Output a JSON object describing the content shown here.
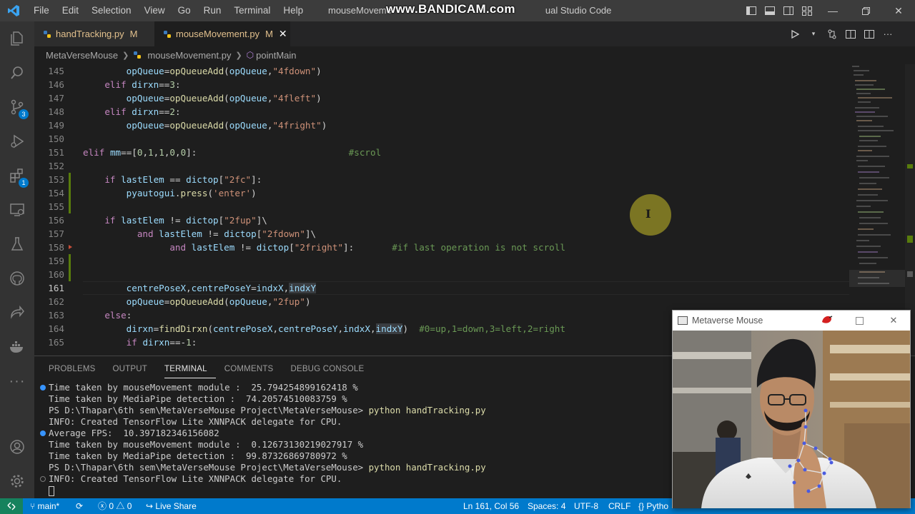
{
  "window": {
    "title": "mouseMovement.py - MetaVerseMouse - Visual Studio Code",
    "title_visible": "mouseMoveme",
    "title_visible_right": "ual Studio Code",
    "watermark": "www.BANDICAM.com"
  },
  "menu": [
    "File",
    "Edit",
    "Selection",
    "View",
    "Go",
    "Run",
    "Terminal",
    "Help"
  ],
  "activity": {
    "source_control_badge": "3",
    "extensions_badge": "1"
  },
  "tabs": [
    {
      "label": "handTracking.py",
      "status": "M"
    },
    {
      "label": "mouseMovement.py",
      "status": "M"
    }
  ],
  "breadcrumb": [
    "MetaVerseMouse",
    "mouseMovement.py",
    "pointMain"
  ],
  "editor": {
    "line_numbers": [
      "145",
      "146",
      "147",
      "148",
      "149",
      "150",
      "151",
      "152",
      "153",
      "154",
      "155",
      "156",
      "157",
      "158",
      "159",
      "160",
      "161",
      "162",
      "163",
      "164",
      "165"
    ]
  },
  "panel": {
    "tabs": [
      "PROBLEMS",
      "OUTPUT",
      "TERMINAL",
      "COMMENTS",
      "DEBUG CONSOLE"
    ],
    "terminal_lines": [
      "Time taken by mouseMovement module :  25.794254899162418 %",
      "Time taken by MediaPipe detection :  74.20574510083759 %",
      "PS D:\\Thapar\\6th sem\\MetaVerseMouse Project\\MetaVerseMouse> ",
      "python handTracking.py",
      "INFO: Created TensorFlow Lite XNNPACK delegate for CPU.",
      "Average FPS:  10.397182346156082",
      "Time taken by mouseMovement module :  0.1267313021902791​7 %",
      "Time taken by MediaPipe detection :  99.87326869780972 %",
      "INFO: Created TensorFlow Lite XNNPACK delegate for CPU."
    ]
  },
  "statusbar": {
    "branch": "main*",
    "errors": "0",
    "warnings": "0",
    "live_share": "Live Share",
    "position": "Ln 161, Col 56",
    "spaces": "Spaces: 4",
    "encoding": "UTF-8",
    "eol": "CRLF",
    "language": "Pytho"
  },
  "webcam": {
    "title": "Metaverse Mouse"
  },
  "colors": {
    "statusbar": "#007acc",
    "titlebar": "#3c3c3c",
    "activitybar": "#333333",
    "editor": "#1e1e1e"
  }
}
